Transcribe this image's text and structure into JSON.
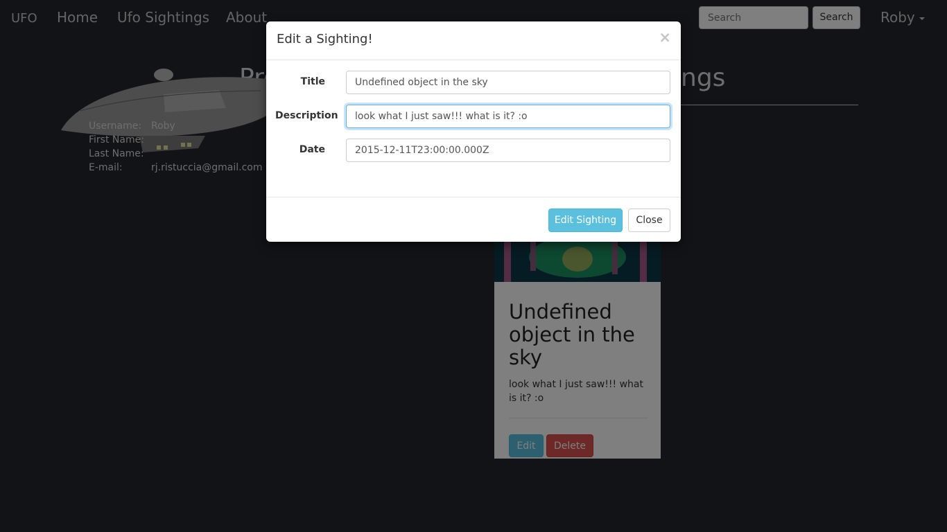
{
  "navbar": {
    "brand": "UFO",
    "links": [
      "Home",
      "Ufo Sightings",
      "About"
    ],
    "search_placeholder": "Search",
    "search_button": "Search",
    "user": "Roby"
  },
  "page": {
    "title_left": "Pro",
    "title_right": "ngs"
  },
  "profile": {
    "rows": [
      {
        "label": "Username:",
        "value": "Roby"
      },
      {
        "label": "First Name:",
        "value": ""
      },
      {
        "label": "Last Name:",
        "value": ""
      },
      {
        "label": "E-mail:",
        "value": "rj.ristuccia@gmail.com"
      }
    ]
  },
  "card": {
    "title": "Undefined object in the sky",
    "description": "look what I just saw!!! what is it? :o",
    "edit_label": "Edit",
    "delete_label": "Delete"
  },
  "modal": {
    "title": "Edit a Sighting!",
    "close_symbol": "×",
    "fields": {
      "title_label": "Title",
      "title_value": "Undefined object in the sky",
      "description_label": "Description",
      "description_value": "look what I just saw!!! what is it? :o",
      "date_label": "Date",
      "date_value": "2015-12-11T23:00:00.000Z"
    },
    "submit_label": "Edit Sighting",
    "close_label": "Close"
  }
}
